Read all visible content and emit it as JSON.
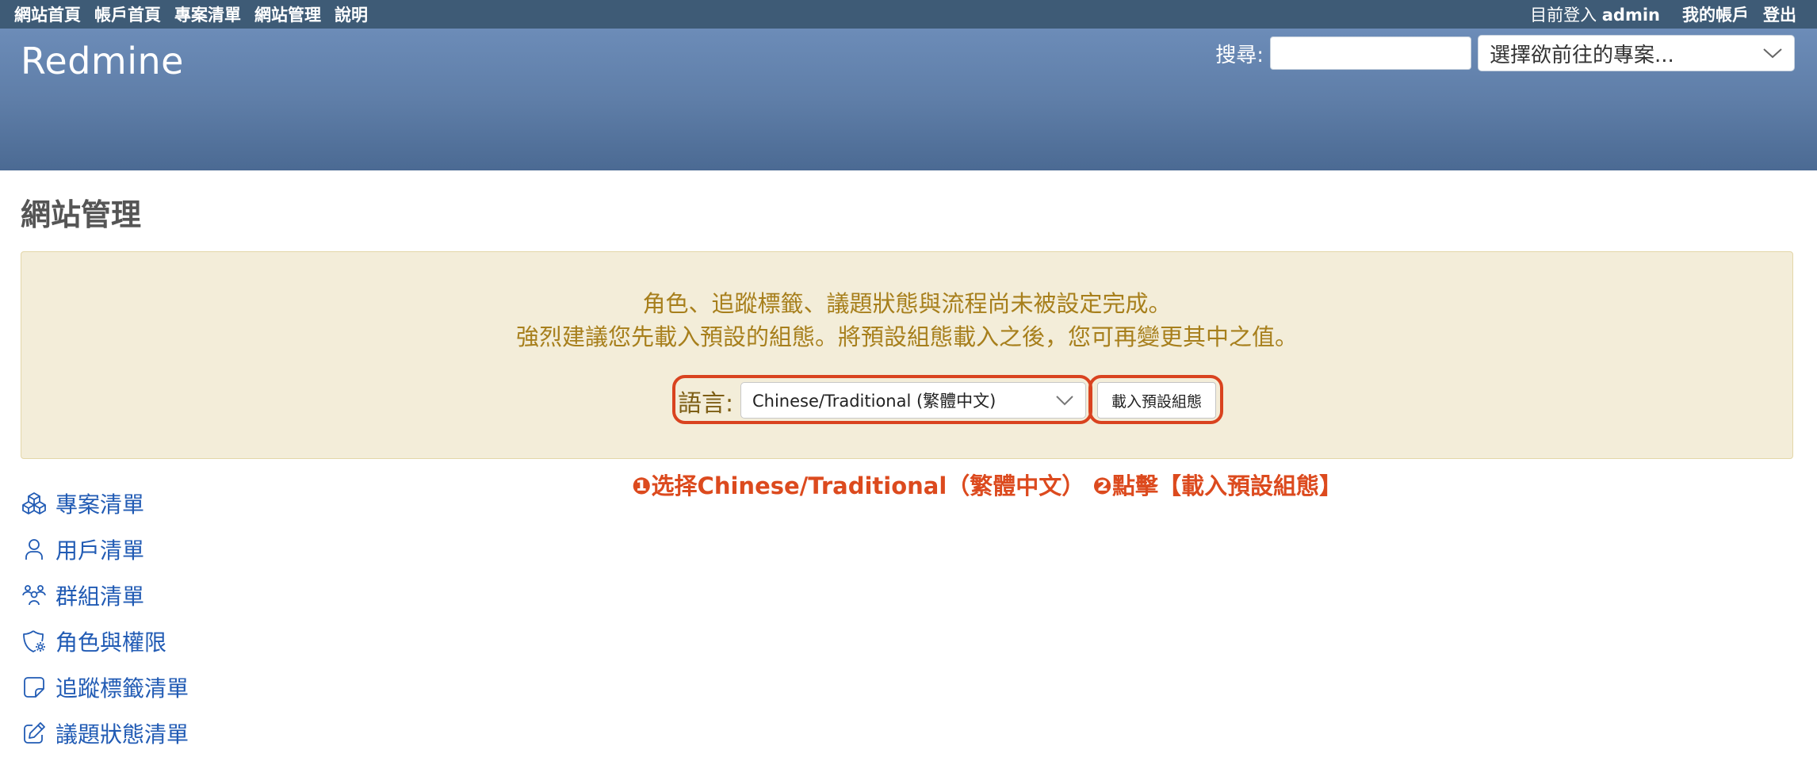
{
  "top_menu": {
    "left_links": [
      "網站首頁",
      "帳戶首頁",
      "專案清單",
      "網站管理",
      "說明"
    ],
    "logged_as_label": "目前登入",
    "logged_as_user": "admin",
    "my_account": "我的帳戶",
    "sign_out": "登出"
  },
  "header": {
    "site_title": "Redmine",
    "search_label": "搜尋:",
    "search_value": "",
    "project_jump_placeholder": "選擇欲前往的專案..."
  },
  "main": {
    "page_title": "網站管理",
    "nodata": {
      "line1": "角色、追蹤標籤、議題狀態與流程尚未被設定完成。",
      "line2": "強烈建議您先載入預設的組態。將預設組態載入之後，您可再變更其中之值。",
      "language_label": "語言:",
      "language_selected": "Chinese/Traditional (繁體中文)",
      "load_button": "載入預設組態"
    },
    "annotation": "❶选择Chinese/Traditional（繁體中文） ❷點擊【載入預設組態】",
    "admin_menu": [
      {
        "label": "專案清單",
        "icon": "projects-icon"
      },
      {
        "label": "用戶清單",
        "icon": "user-icon"
      },
      {
        "label": "群組清單",
        "icon": "group-icon"
      },
      {
        "label": "角色與權限",
        "icon": "shield-gear-icon"
      },
      {
        "label": "追蹤標籤清單",
        "icon": "sticky-note-icon"
      },
      {
        "label": "議題狀態清單",
        "icon": "edit-icon"
      }
    ]
  },
  "colors": {
    "top_menu_bg": "#3e5b76",
    "header_bg": "#5f7ea8",
    "link": "#215bb4",
    "warning_bg": "#f3edd9",
    "warning_text": "#a77f1c",
    "annotation_red": "#dc4a1e"
  }
}
